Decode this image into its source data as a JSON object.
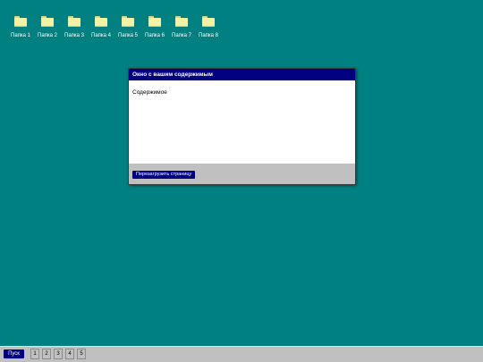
{
  "desktop": {
    "background_color": "#008080",
    "icons": [
      {
        "label": "Папка 1",
        "icon": "folder-icon"
      },
      {
        "label": "Папка 2",
        "icon": "folder-icon"
      },
      {
        "label": "Папка 3",
        "icon": "folder-icon"
      },
      {
        "label": "Папка 4",
        "icon": "folder-icon"
      },
      {
        "label": "Папка 5",
        "icon": "folder-icon"
      },
      {
        "label": "Папка 6",
        "icon": "folder-icon"
      },
      {
        "label": "Папка 7",
        "icon": "folder-icon"
      },
      {
        "label": "Папка 8",
        "icon": "folder-icon"
      }
    ]
  },
  "window": {
    "title": "Окно с вашим содержимым",
    "content_text": "Содержимое",
    "reload_button_label": "Перезагрузить страницу",
    "titlebar_color": "#000080"
  },
  "taskbar": {
    "start_label": "Пуск",
    "buttons": [
      "1",
      "2",
      "3",
      "4",
      "5"
    ]
  }
}
